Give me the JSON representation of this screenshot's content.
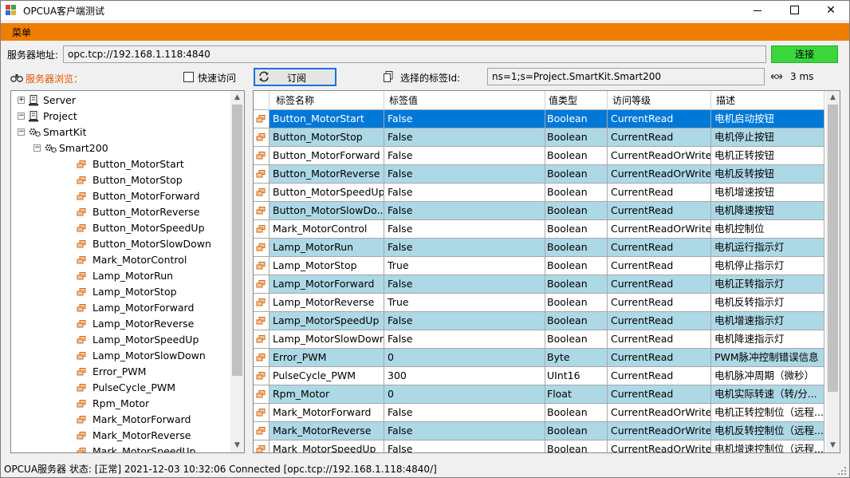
{
  "window": {
    "title": "OPCUA客户端测试",
    "controls": {
      "minimize": "minimize",
      "maximize": "maximize",
      "close": "close"
    }
  },
  "menu": {
    "items": [
      "菜单"
    ]
  },
  "server": {
    "label": "服务器地址:",
    "address": "opc.tcp://192.168.1.118:4840",
    "connect_label": "连接"
  },
  "toolbar": {
    "browse_label": "服务器浏览：",
    "quick_access_label": "快速访问",
    "quick_access_checked": false,
    "subscribe_label": "订阅",
    "selected_tag_label": "选择的标签Id:",
    "selected_tag_value": "ns=1;s=Project.SmartKit.Smart200",
    "interval": "3 ms"
  },
  "tree": {
    "nodes": [
      {
        "label": "Server",
        "level": 0,
        "expander": "+",
        "icon": "server-icon"
      },
      {
        "label": "Project",
        "level": 0,
        "expander": "-",
        "icon": "server-icon"
      },
      {
        "label": "SmartKit",
        "level": 1,
        "expander": "-",
        "icon": "gears-icon"
      },
      {
        "label": "Smart200",
        "level": 2,
        "expander": "-",
        "icon": "gears-icon"
      },
      {
        "label": "Button_MotorStart",
        "level": 3,
        "icon": "tag-icon"
      },
      {
        "label": "Button_MotorStop",
        "level": 3,
        "icon": "tag-icon"
      },
      {
        "label": "Button_MotorForward",
        "level": 3,
        "icon": "tag-icon"
      },
      {
        "label": "Button_MotorReverse",
        "level": 3,
        "icon": "tag-icon"
      },
      {
        "label": "Button_MotorSpeedUp",
        "level": 3,
        "icon": "tag-icon"
      },
      {
        "label": "Button_MotorSlowDown",
        "level": 3,
        "icon": "tag-icon"
      },
      {
        "label": "Mark_MotorControl",
        "level": 3,
        "icon": "tag-icon"
      },
      {
        "label": "Lamp_MotorRun",
        "level": 3,
        "icon": "tag-icon"
      },
      {
        "label": "Lamp_MotorStop",
        "level": 3,
        "icon": "tag-icon"
      },
      {
        "label": "Lamp_MotorForward",
        "level": 3,
        "icon": "tag-icon"
      },
      {
        "label": "Lamp_MotorReverse",
        "level": 3,
        "icon": "tag-icon"
      },
      {
        "label": "Lamp_MotorSpeedUp",
        "level": 3,
        "icon": "tag-icon"
      },
      {
        "label": "Lamp_MotorSlowDown",
        "level": 3,
        "icon": "tag-icon"
      },
      {
        "label": "Error_PWM",
        "level": 3,
        "icon": "tag-icon"
      },
      {
        "label": "PulseCycle_PWM",
        "level": 3,
        "icon": "tag-icon"
      },
      {
        "label": "Rpm_Motor",
        "level": 3,
        "icon": "tag-icon"
      },
      {
        "label": "Mark_MotorForward",
        "level": 3,
        "icon": "tag-icon"
      },
      {
        "label": "Mark_MotorReverse",
        "level": 3,
        "icon": "tag-icon"
      },
      {
        "label": "Mark_MotorSpeedUp",
        "level": 3,
        "icon": "tag-icon"
      }
    ]
  },
  "grid": {
    "columns": [
      "标签名称",
      "标签值",
      "值类型",
      "访问等级",
      "描述"
    ],
    "rows": [
      [
        "Button_MotorStart",
        "False",
        "Boolean",
        "CurrentRead",
        "电机启动按钮"
      ],
      [
        "Button_MotorStop",
        "False",
        "Boolean",
        "CurrentRead",
        "电机停止按钮"
      ],
      [
        "Button_MotorForward",
        "False",
        "Boolean",
        "CurrentReadOrWrite",
        "电机正转按钮"
      ],
      [
        "Button_MotorReverse",
        "False",
        "Boolean",
        "CurrentReadOrWrite",
        "电机反转按钮"
      ],
      [
        "Button_MotorSpeedUp",
        "False",
        "Boolean",
        "CurrentRead",
        "电机增速按钮"
      ],
      [
        "Button_MotorSlowDo...",
        "False",
        "Boolean",
        "CurrentRead",
        "电机降速按钮"
      ],
      [
        "Mark_MotorControl",
        "False",
        "Boolean",
        "CurrentReadOrWrite",
        "电机控制位"
      ],
      [
        "Lamp_MotorRun",
        "False",
        "Boolean",
        "CurrentRead",
        "电机运行指示灯"
      ],
      [
        "Lamp_MotorStop",
        "True",
        "Boolean",
        "CurrentRead",
        "电机停止指示灯"
      ],
      [
        "Lamp_MotorForward",
        "False",
        "Boolean",
        "CurrentRead",
        "电机正转指示灯"
      ],
      [
        "Lamp_MotorReverse",
        "True",
        "Boolean",
        "CurrentRead",
        "电机反转指示灯"
      ],
      [
        "Lamp_MotorSpeedUp",
        "False",
        "Boolean",
        "CurrentRead",
        "电机增速指示灯"
      ],
      [
        "Lamp_MotorSlowDown",
        "False",
        "Boolean",
        "CurrentRead",
        "电机降速指示灯"
      ],
      [
        "Error_PWM",
        "0",
        "Byte",
        "CurrentRead",
        "PWM脉冲控制错误信息"
      ],
      [
        "PulseCycle_PWM",
        "300",
        "UInt16",
        "CurrentRead",
        "电机脉冲周期（微秒）"
      ],
      [
        "Rpm_Motor",
        "0",
        "Float",
        "CurrentRead",
        "电机实际转速（转/分..."
      ],
      [
        "Mark_MotorForward",
        "False",
        "Boolean",
        "CurrentReadOrWrite",
        "电机正转控制位（远程..."
      ],
      [
        "Mark_MotorReverse",
        "False",
        "Boolean",
        "CurrentReadOrWrite",
        "电机反转控制位（远程..."
      ],
      [
        "Mark_MotorSpeedUp",
        "False",
        "Boolean",
        "CurrentReadOrWrite",
        "电机增速控制位（远程..."
      ]
    ],
    "selected_row": 0
  },
  "status": {
    "text": "OPCUA服务器 状态:   [正常]   2021-12-03 10:32:06   Connected [opc.tcp://192.168.1.118:4840/]"
  },
  "colors": {
    "menubar": "#ef7d00",
    "connect_button": "#3bd63b",
    "row_alt": "#add8e6",
    "row_selected": "#0078d7",
    "browse_label": "#e05a00"
  }
}
